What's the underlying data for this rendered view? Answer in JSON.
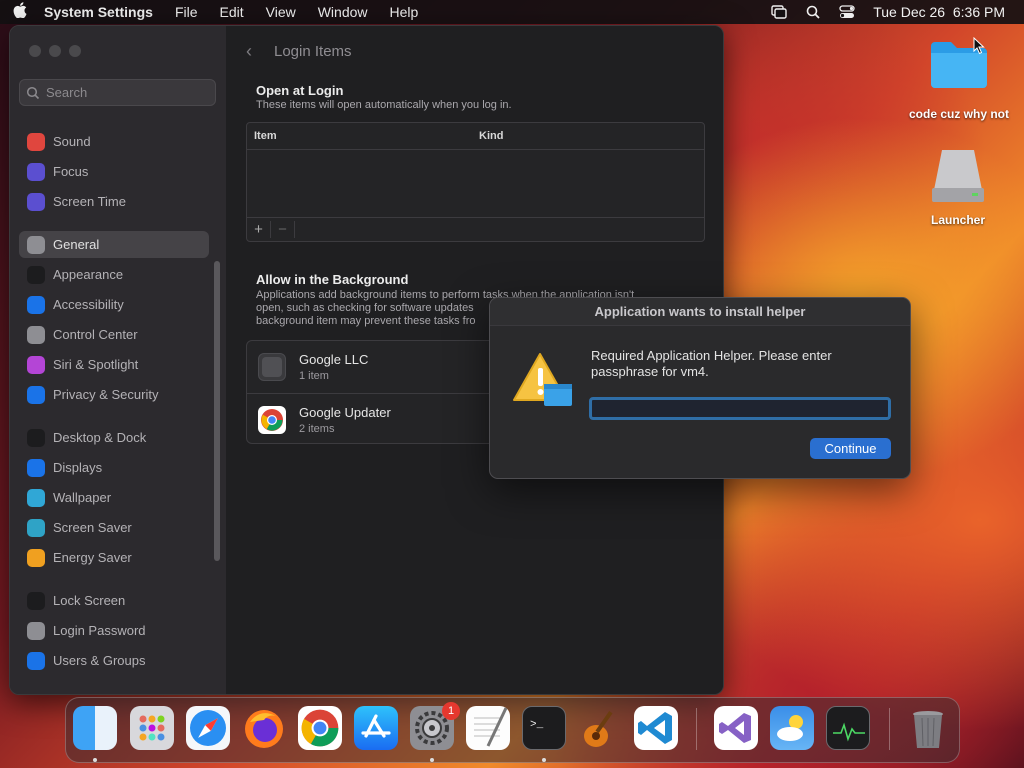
{
  "menubar": {
    "app_name": "System Settings",
    "menus": [
      "File",
      "Edit",
      "View",
      "Window",
      "Help"
    ],
    "datetime": "Tue Dec 26  6:36 PM"
  },
  "settings": {
    "search_placeholder": "Search",
    "sidebar": [
      {
        "label": "Sound",
        "icon": "sound-icon",
        "color": "#e0463e"
      },
      {
        "label": "Focus",
        "icon": "focus-moon-icon",
        "color": "#5b4fd0"
      },
      {
        "label": "Screen Time",
        "icon": "hourglass-icon",
        "color": "#5b4fd0"
      },
      {
        "label": "General",
        "icon": "gear-icon",
        "color": "#8e8e93",
        "active": true
      },
      {
        "label": "Appearance",
        "icon": "appearance-icon",
        "color": "#1c1c1e"
      },
      {
        "label": "Accessibility",
        "icon": "accessibility-icon",
        "color": "#1a73e8"
      },
      {
        "label": "Control Center",
        "icon": "control-center-icon",
        "color": "#8e8e93"
      },
      {
        "label": "Siri & Spotlight",
        "icon": "siri-icon",
        "color": "#b445d6"
      },
      {
        "label": "Privacy & Security",
        "icon": "hand-icon",
        "color": "#1a73e8"
      },
      {
        "label": "Desktop & Dock",
        "icon": "dock-icon",
        "color": "#1c1c1e"
      },
      {
        "label": "Displays",
        "icon": "displays-icon",
        "color": "#1a73e8"
      },
      {
        "label": "Wallpaper",
        "icon": "wallpaper-icon",
        "color": "#30a7d6"
      },
      {
        "label": "Screen Saver",
        "icon": "screen-saver-icon",
        "color": "#2fa3c6"
      },
      {
        "label": "Energy Saver",
        "icon": "battery-icon",
        "color": "#f0a020"
      },
      {
        "label": "Lock Screen",
        "icon": "lock-icon",
        "color": "#1c1c1e"
      },
      {
        "label": "Login Password",
        "icon": "key-icon",
        "color": "#8e8e93"
      },
      {
        "label": "Users & Groups",
        "icon": "users-icon",
        "color": "#1a73e8"
      }
    ],
    "page_title": "Login Items",
    "open_at_login": {
      "title": "Open at Login",
      "subtitle": "These items will open automatically when you log in.",
      "columns": [
        "Item",
        "Kind"
      ],
      "add": "+",
      "remove": "−"
    },
    "background": {
      "title": "Allow in the Background",
      "subtitle_lines": [
        "Applications add background items to perform tasks when the application isn't",
        "open, such as checking for software updates",
        "background item may prevent these tasks fro"
      ],
      "items": [
        {
          "name": "Google LLC",
          "count": "1 item",
          "icon": "generic-app-icon"
        },
        {
          "name": "Google Updater",
          "count": "2 items",
          "icon": "chrome-icon"
        }
      ]
    }
  },
  "dialog": {
    "title": "Application wants to install helper",
    "message": "Required Application Helper. Please enter passphrase for vm4.",
    "password_value": "",
    "continue_label": "Continue"
  },
  "desktop": {
    "folder_label": "code cuz why not",
    "drive_label": "Launcher"
  },
  "dock": {
    "apps": [
      "Finder",
      "Launchpad",
      "Safari",
      "Firefox",
      "Chrome",
      "App Store",
      "System Settings",
      "TextEdit",
      "Terminal",
      "GarageBand",
      "Visual Studio Code",
      "Visual Studio",
      "Weather",
      "Activity Monitor",
      "Trash"
    ],
    "settings_badge": "1"
  }
}
